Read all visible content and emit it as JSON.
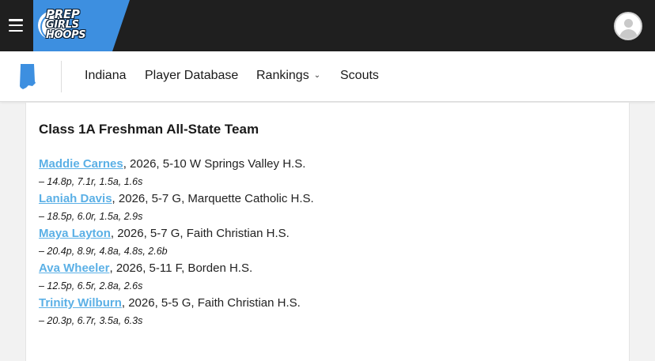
{
  "header": {
    "logo": {
      "line1": "PREP",
      "line2": "GIRLS",
      "line3": "HOOPS"
    },
    "menu_icon": "hamburger-menu-icon",
    "avatar_icon": "user-avatar-icon"
  },
  "nav": {
    "state_icon": "indiana-state-icon",
    "items": [
      {
        "label": "Indiana"
      },
      {
        "label": "Player Database"
      },
      {
        "label": "Rankings"
      },
      {
        "label": "Scouts"
      }
    ]
  },
  "colors": {
    "header_bg": "#1f1f1f",
    "brand_blue": "#3d8fe0",
    "link_blue": "#5bb0e6"
  },
  "content": {
    "title": "Class 1A Freshman All-State Team",
    "players": [
      {
        "name": "Maddie Carnes",
        "details": ", 2026, 5-10 W Springs Valley H.S.",
        "stats": "– 14.8p, 7.1r, 1.5a, 1.6s"
      },
      {
        "name": "Laniah Davis",
        "details": ", 2026, 5-7 G, Marquette Catholic H.S.",
        "stats": "– 18.5p, 6.0r, 1.5a, 2.9s"
      },
      {
        "name": "Maya Layton",
        "details": ", 2026, 5-7 G, Faith Christian H.S.",
        "stats": "– 20.4p, 8.9r, 4.8a, 4.8s, 2.6b"
      },
      {
        "name": "Ava Wheeler",
        "details": ", 2026, 5-11 F, Borden H.S.",
        "stats": "– 12.5p, 6.5r, 2.8a, 2.6s"
      },
      {
        "name": "Trinity Wilburn",
        "details": ", 2026, 5-5 G, Faith Christian H.S.",
        "stats": "– 20.3p, 6.7r, 3.5a, 6.3s"
      }
    ]
  }
}
